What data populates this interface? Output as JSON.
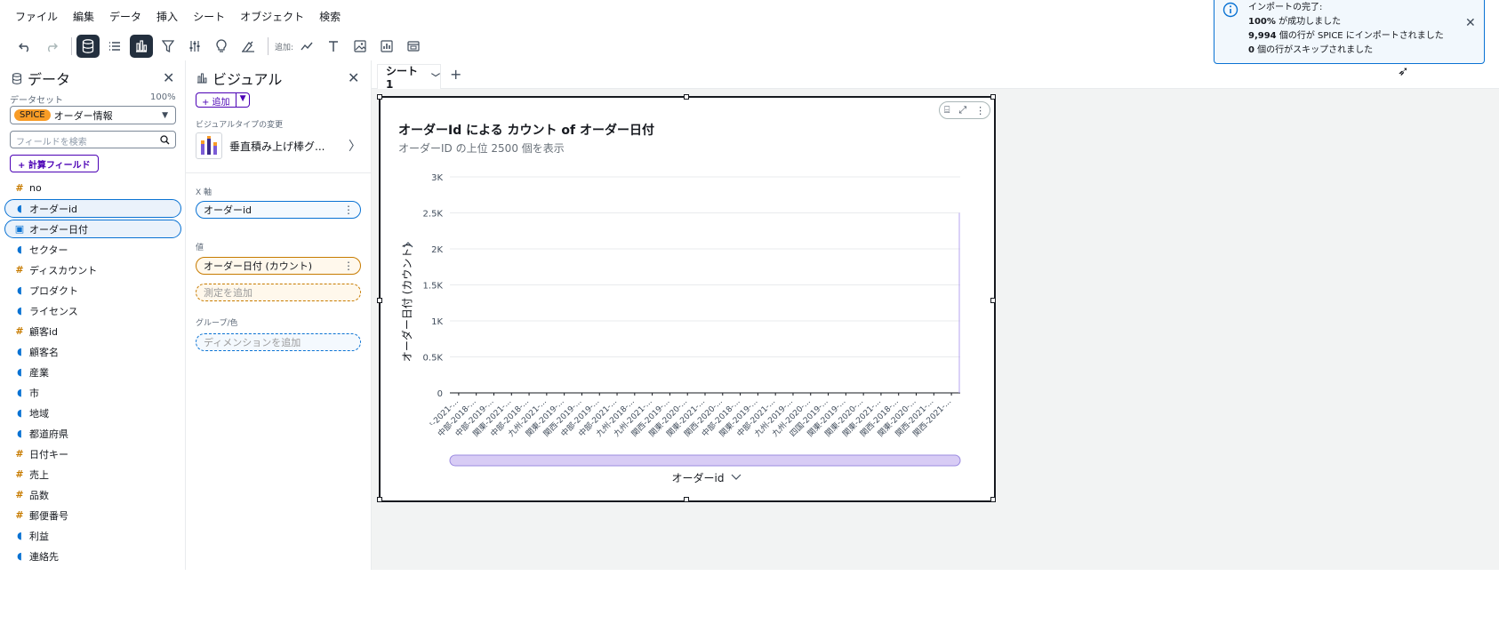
{
  "menu": [
    "ファイル",
    "編集",
    "データ",
    "挿入",
    "シート",
    "オブジェクト",
    "検索"
  ],
  "toolbar": {
    "add_label": "追加:"
  },
  "data_panel": {
    "title": "データ",
    "dataset_label": "データセット",
    "dataset_pct": "100%",
    "spice": "SPICE",
    "dataset_name": "オーダー情報",
    "search_placeholder": "フィールドを検索",
    "calc_button": "+ 計算フィールド",
    "fields": [
      {
        "label": "no",
        "kind": "num"
      },
      {
        "label": "オーダーid",
        "kind": "dim"
      },
      {
        "label": "オーダー日付",
        "kind": "date"
      },
      {
        "label": "セクター",
        "kind": "dim"
      },
      {
        "label": "ディスカウント",
        "kind": "num"
      },
      {
        "label": "プロダクト",
        "kind": "dim"
      },
      {
        "label": "ライセンス",
        "kind": "dim"
      },
      {
        "label": "顧客id",
        "kind": "num"
      },
      {
        "label": "顧客名",
        "kind": "dim"
      },
      {
        "label": "産業",
        "kind": "dim"
      },
      {
        "label": "市",
        "kind": "dim"
      },
      {
        "label": "地域",
        "kind": "dim"
      },
      {
        "label": "都道府県",
        "kind": "dim"
      },
      {
        "label": "日付キー",
        "kind": "num"
      },
      {
        "label": "売上",
        "kind": "num"
      },
      {
        "label": "品数",
        "kind": "num"
      },
      {
        "label": "郵便番号",
        "kind": "num"
      },
      {
        "label": "利益",
        "kind": "dim"
      },
      {
        "label": "連絡先",
        "kind": "dim"
      }
    ]
  },
  "visual_panel": {
    "title": "ビジュアル",
    "add_button": "+ 追加",
    "visual_type_label": "ビジュアルタイプの変更",
    "visual_type": "垂直積み上げ棒グ...",
    "x_axis_label": "X 軸",
    "x_axis_field": "オーダーid",
    "value_label": "値",
    "value_field": "オーダー日付 (カウント)",
    "add_measure": "測定を追加",
    "group_label": "グループ/色",
    "add_dimension": "ディメンションを追加"
  },
  "sheet": {
    "tab": "シート 1"
  },
  "visual": {
    "title": "オーダーId による カウント of オーダー日付",
    "subtitle": "オーダーID の上位 2500 個を表示"
  },
  "chart_data": {
    "type": "bar",
    "title": "オーダーId による カウント of オーダー日付",
    "subtitle": "オーダーID の上位 2500 個を表示",
    "xlabel": "オーダーid",
    "ylabel": "オーダー日付 (カウント)",
    "ylim": [
      0,
      3000
    ],
    "yticks": [
      "0",
      "0.5K",
      "1K",
      "1.5K",
      "2K",
      "2.5K",
      "3K"
    ],
    "categories": [
      "ᵗ-2021-...",
      "中部-2018-...",
      "中部-2019-...",
      "関東-2021-...",
      "中部-2018-...",
      "九州-2021-...",
      "関東-2019-...",
      "関西-2019-...",
      "中部-2019-...",
      "中部-2021-...",
      "九州-2018-...",
      "九州-2021-...",
      "関西-2019-...",
      "関東-2020-...",
      "関東-2021-...",
      "関西-2020-...",
      "中部-2018-...",
      "関東-2019-...",
      "中部-2021-...",
      "九州-2019-...",
      "九州-2020-...",
      "四国-2019-...",
      "関東-2019-...",
      "関東-2020-...",
      "関東-2021-...",
      "関西-2018-...",
      "関東-2020-...",
      "関西-2021-...",
      "関西-2021-..."
    ],
    "grid": true
  },
  "toast": {
    "title": "インポートの完了:",
    "l1_bold": "100%",
    "l1": " が成功しました",
    "l2_bold": "9,994",
    "l2": " 個の行が SPICE にインポートされました",
    "l3_bold": "0",
    "l3": " 個の行がスキップされました"
  },
  "colors": {
    "accent": "#4b00b5",
    "spice": "#f89c26",
    "info": "#0972d3",
    "scroll": "#d8ccf5"
  }
}
